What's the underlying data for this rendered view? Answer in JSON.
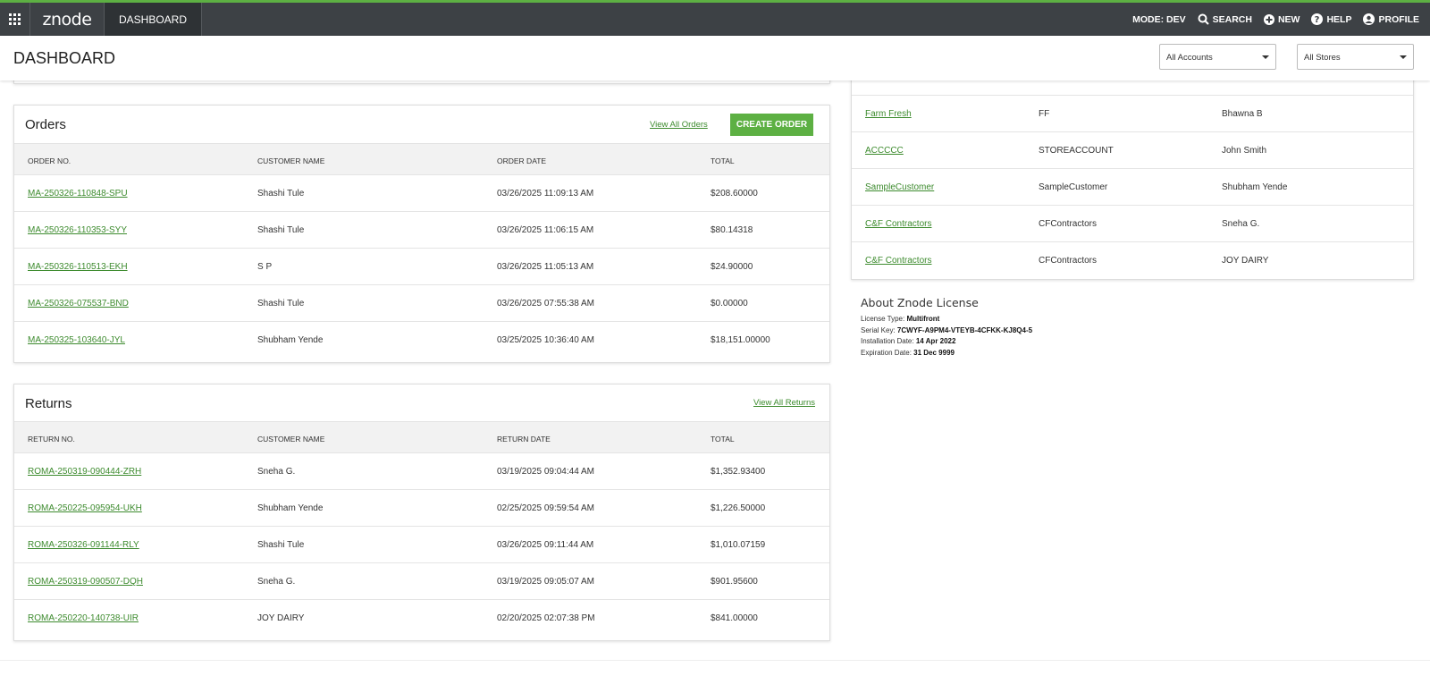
{
  "nav": {
    "logo": "znode",
    "dashboard_tab": "DASHBOARD",
    "mode": "MODE: DEV",
    "search": "SEARCH",
    "new": "NEW",
    "help": "HELP",
    "profile": "PROFILE"
  },
  "header": {
    "title": "DASHBOARD",
    "accounts_select": "All Accounts",
    "stores_select": "All Stores"
  },
  "orders": {
    "title": "Orders",
    "view_all": "View All Orders",
    "create_button": "CREATE ORDER",
    "columns": [
      "ORDER NO.",
      "CUSTOMER NAME",
      "ORDER DATE",
      "TOTAL"
    ],
    "rows": [
      {
        "no": "MA-250326-110848-SPU",
        "customer": "Shashi Tule",
        "date": "03/26/2025 11:09:13 AM",
        "total": "$208.60000"
      },
      {
        "no": "MA-250326-110353-SYY",
        "customer": "Shashi Tule",
        "date": "03/26/2025 11:06:15 AM",
        "total": "$80.14318"
      },
      {
        "no": "MA-250326-110513-EKH",
        "customer": "S P",
        "date": "03/26/2025 11:05:13 AM",
        "total": "$24.90000"
      },
      {
        "no": "MA-250326-075537-BND",
        "customer": "Shashi Tule",
        "date": "03/26/2025 07:55:38 AM",
        "total": "$0.00000"
      },
      {
        "no": "MA-250325-103640-JYL",
        "customer": "Shubham Yende",
        "date": "03/25/2025 10:36:40 AM",
        "total": "$18,151.00000"
      }
    ]
  },
  "returns": {
    "title": "Returns",
    "view_all": "View All Returns",
    "columns": [
      "RETURN NO.",
      "CUSTOMER NAME",
      "RETURN DATE",
      "TOTAL"
    ],
    "rows": [
      {
        "no": "ROMA-250319-090444-ZRH",
        "customer": "Sneha G.",
        "date": "03/19/2025 09:04:44 AM",
        "total": "$1,352.93400"
      },
      {
        "no": "ROMA-250225-095954-UKH",
        "customer": "Shubham Yende",
        "date": "02/25/2025 09:59:54 AM",
        "total": "$1,226.50000"
      },
      {
        "no": "ROMA-250326-091144-RLY",
        "customer": "Shashi Tule",
        "date": "03/26/2025 09:11:44 AM",
        "total": "$1,010.07159"
      },
      {
        "no": "ROMA-250319-090507-DQH",
        "customer": "Sneha G.",
        "date": "03/19/2025 09:05:07 AM",
        "total": "$901.95600"
      },
      {
        "no": "ROMA-250220-140738-UIR",
        "customer": "JOY DAIRY",
        "date": "02/20/2025 02:07:38 PM",
        "total": "$841.00000"
      }
    ]
  },
  "accounts": {
    "rows": [
      {
        "name": "Farm Fresh",
        "code": "FF",
        "contact": "Bhawna B"
      },
      {
        "name": "ACCCCC",
        "code": "STOREACCOUNT",
        "contact": "John Smith"
      },
      {
        "name": "SampleCustomer",
        "code": "SampleCustomer",
        "contact": "Shubham Yende"
      },
      {
        "name": "C&F Contractors",
        "code": "CFContractors",
        "contact": "Sneha G."
      },
      {
        "name": "C&F Contractors",
        "code": "CFContractors",
        "contact": "JOY DAIRY"
      }
    ]
  },
  "license": {
    "title": "About Znode License",
    "type_label": "License Type:",
    "type_value": "Multifront",
    "serial_label": "Serial Key:",
    "serial_value": "7CWYF-A9PM4-VTEYB-4CFKK-KJ8Q4-5",
    "install_label": "Installation Date:",
    "install_value": "14 Apr 2022",
    "expiry_label": "Expiration Date:",
    "expiry_value": "31 Dec 9999"
  },
  "colors": {
    "nav_bg": "#3d4145",
    "accent": "#5db043",
    "link": "#3d8b2e"
  }
}
